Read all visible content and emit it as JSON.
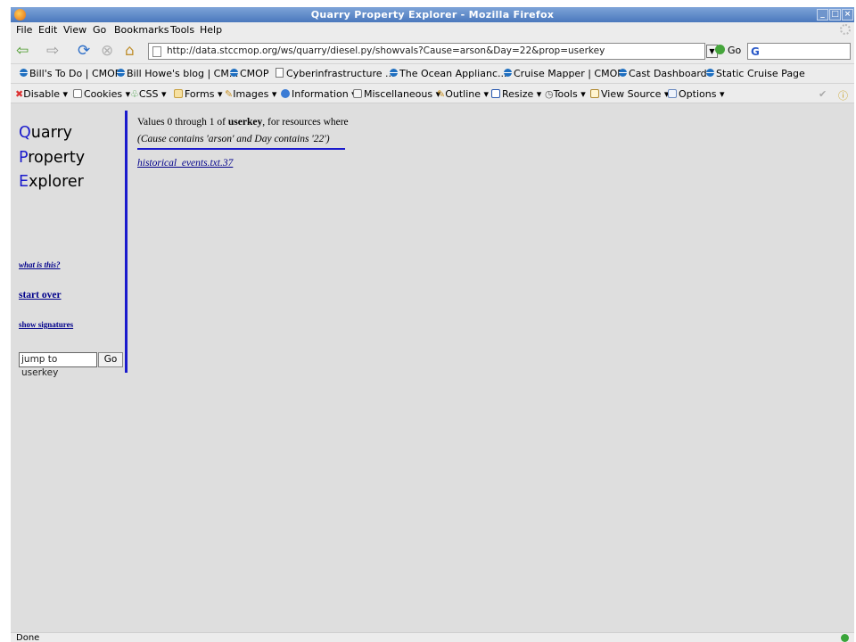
{
  "window": {
    "title": "Quarry Property Explorer - Mozilla Firefox"
  },
  "menubar": {
    "items": [
      "File",
      "Edit",
      "View",
      "Go",
      "Bookmarks",
      "Tools",
      "Help"
    ]
  },
  "navbar": {
    "url": "http://data.stccmop.org/ws/quarry/diesel.py/showvals?Cause=arson&Day=22&prop=userkey",
    "go_label": "Go",
    "search_icon": "G"
  },
  "bookmarks": [
    {
      "label": "Bill's To Do | CMOP",
      "icon": "cmop-icon"
    },
    {
      "label": "Bill Howe's blog | CM...",
      "icon": "cmop-icon"
    },
    {
      "label": "CMOP",
      "icon": "cmop-icon"
    },
    {
      "label": "Cyberinfrastructure ...",
      "icon": "page-icon"
    },
    {
      "label": "The Ocean Applianc...",
      "icon": "cmop-icon"
    },
    {
      "label": "Cruise Mapper | CMOP",
      "icon": "cmop-icon"
    },
    {
      "label": "Cast Dashboard",
      "icon": "cmop-icon"
    },
    {
      "label": "Static Cruise Page",
      "icon": "cmop-icon"
    }
  ],
  "devbar": {
    "items": [
      "Disable",
      "Cookies",
      "CSS",
      "Forms",
      "Images",
      "Information",
      "Miscellaneous",
      "Outline",
      "Resize",
      "Tools",
      "View Source",
      "Options"
    ]
  },
  "sidebar": {
    "logo": [
      {
        "cap": "Q",
        "rest": "uarry"
      },
      {
        "cap": "P",
        "rest": "roperty"
      },
      {
        "cap": "E",
        "rest": "xplorer"
      }
    ],
    "what_is_this": "what is this?",
    "start_over": "start over",
    "show_signatures": "show signatures",
    "jump_placeholder": "jump to userkey",
    "jump_go": "Go"
  },
  "main": {
    "prefix": "Values 0 through 1 of ",
    "property": "userkey",
    "mid": ", for resources where ",
    "condition": "(Cause contains 'arson' and Day contains '22')",
    "results": [
      "historical_events.txt.37"
    ]
  },
  "status": {
    "text": "Done"
  }
}
